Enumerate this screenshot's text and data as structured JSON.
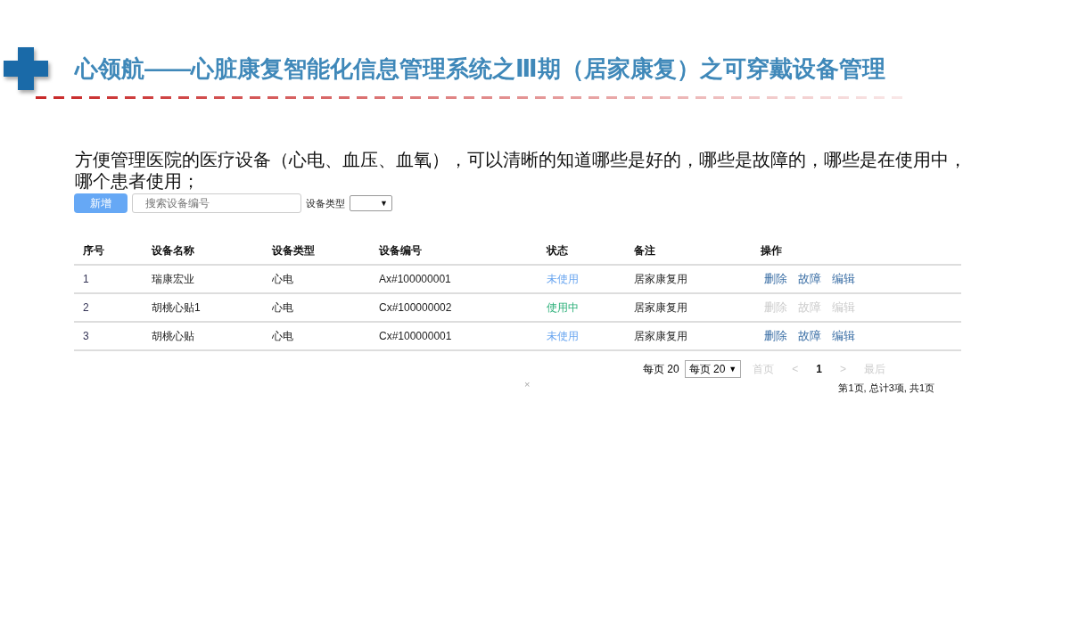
{
  "title": "心领航——心脏康复智能化信息管理系统之Ⅲ期（居家康复）之可穿戴设备管理",
  "description": "方便管理医院的医疗设备（心电、血压、血氧），可以清晰的知道哪些是好的，哪些是故障的，哪些是在使用中，哪个患者使用；",
  "toolbar": {
    "add_button": "新增",
    "search": {
      "placeholder": "搜索设备编号"
    },
    "type_filter": {
      "label": "设备类型",
      "value_arrow": "▼"
    }
  },
  "table": {
    "columns": [
      "序号",
      "设备名称",
      "设备类型",
      "设备编号",
      "状态",
      "备注",
      "操作"
    ],
    "rows": [
      {
        "index": "1",
        "name": "瑞康宏业",
        "type": "心电",
        "code": "Ax#100000001",
        "status": {
          "text": "未使用",
          "kind": "unused"
        },
        "note": "居家康复用",
        "actions": [
          {
            "label": "删除",
            "disabled": false
          },
          {
            "label": "故障",
            "disabled": false
          },
          {
            "label": "编辑",
            "disabled": false
          }
        ]
      },
      {
        "index": "2",
        "name": "胡桃心贴1",
        "type": "心电",
        "code": "Cx#100000002",
        "status": {
          "text": "使用中",
          "kind": "in_use"
        },
        "note": "居家康复用",
        "actions": [
          {
            "label": "删除",
            "disabled": true
          },
          {
            "label": "故障",
            "disabled": true
          },
          {
            "label": "编辑",
            "disabled": true
          }
        ]
      },
      {
        "index": "3",
        "name": "胡桃心贴",
        "type": "心电",
        "code": "Cx#100000001",
        "status": {
          "text": "未使用",
          "kind": "unused"
        },
        "note": "居家康复用",
        "actions": [
          {
            "label": "删除",
            "disabled": false
          },
          {
            "label": "故障",
            "disabled": false
          },
          {
            "label": "编辑",
            "disabled": false
          }
        ]
      }
    ]
  },
  "pagination": {
    "page_size_label": "每页 20",
    "page_size_select": "每页 20",
    "select_arrow": "▼",
    "pages": [
      {
        "label": "首页",
        "disabled": true,
        "selected": false
      },
      {
        "label": "<",
        "disabled": true,
        "selected": false
      },
      {
        "label": "1",
        "disabled": false,
        "selected": true
      },
      {
        "label": ">",
        "disabled": true,
        "selected": false
      },
      {
        "label": "最后",
        "disabled": true,
        "selected": false
      }
    ],
    "summary": "第1页, 总计3项, 共1页"
  },
  "close_mark": "×"
}
